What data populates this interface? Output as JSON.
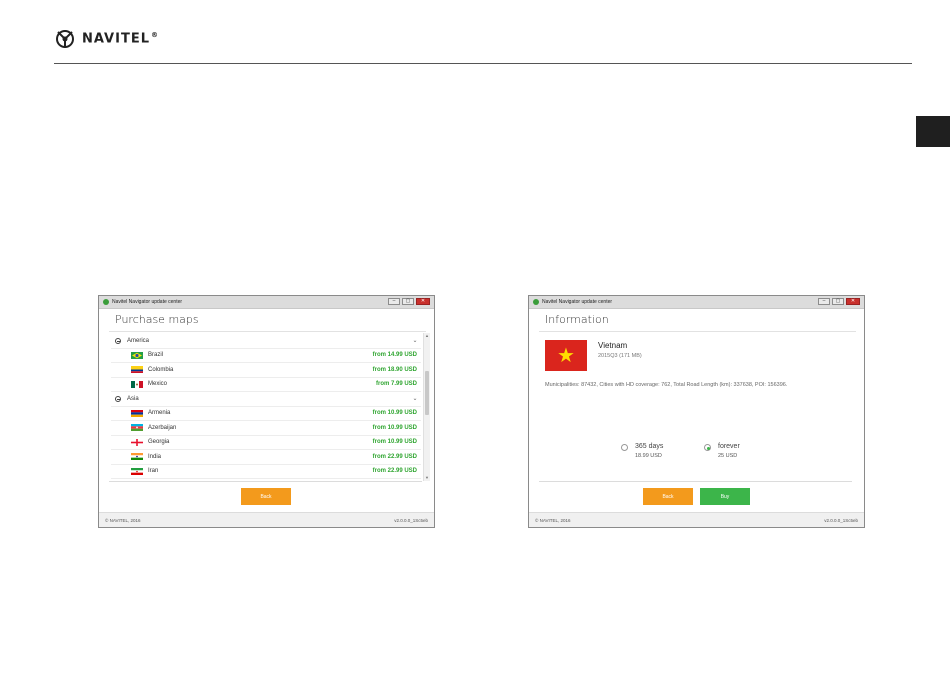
{
  "brand": {
    "name": "NAVITEL",
    "registered": "®"
  },
  "windows": {
    "left": {
      "title": "Navitel Navigator update center",
      "controls": [
        "–",
        "▢",
        "✕"
      ],
      "heading": "Purchase maps",
      "groups": [
        {
          "label": "America",
          "items": [
            {
              "name": "Brazil",
              "price": "from 14.99 USD",
              "flag": "brazil"
            },
            {
              "name": "Colombia",
              "price": "from 18.90 USD",
              "flag": "colombia"
            },
            {
              "name": "Mexico",
              "price": "from 7.99 USD",
              "flag": "mexico"
            }
          ]
        },
        {
          "label": "Asia",
          "items": [
            {
              "name": "Armenia",
              "price": "from 10.99 USD",
              "flag": "armenia"
            },
            {
              "name": "Azerbaijan",
              "price": "from 10.99 USD",
              "flag": "azerbaijan"
            },
            {
              "name": "Georgia",
              "price": "from 10.99 USD",
              "flag": "georgia"
            },
            {
              "name": "India",
              "price": "from 22.99 USD",
              "flag": "india"
            },
            {
              "name": "Iran",
              "price": "from 22.99 USD",
              "flag": "iran"
            }
          ]
        }
      ],
      "back_label": "Back",
      "footer_copy": "© NAVITEL, 2016",
      "footer_version": "v2.0.0.0_1Sc5eb"
    },
    "right": {
      "title": "Navitel Navigator update center",
      "controls": [
        "–",
        "▢",
        "✕"
      ],
      "heading": "Information",
      "map_name": "Vietnam",
      "map_version": "2015Q3 (171 MB)",
      "map_stats": "Municipalities: 87432, Cities with HD coverage: 762, Total Road Length (km): 337638, POI: 156396.",
      "options": [
        {
          "label": "365 days",
          "price": "18.99 USD",
          "selected": false
        },
        {
          "label": "forever",
          "price": "25 USD",
          "selected": true
        }
      ],
      "back_label": "Back",
      "buy_label": "Buy",
      "footer_copy": "© NAVITEL, 2016",
      "footer_version": "v2.0.0.0_1Sc5eb"
    }
  },
  "colors": {
    "accent_green": "#3cb54a",
    "price_green": "#2fa530",
    "button_orange": "#f39a1c",
    "close_red": "#c9302c"
  }
}
